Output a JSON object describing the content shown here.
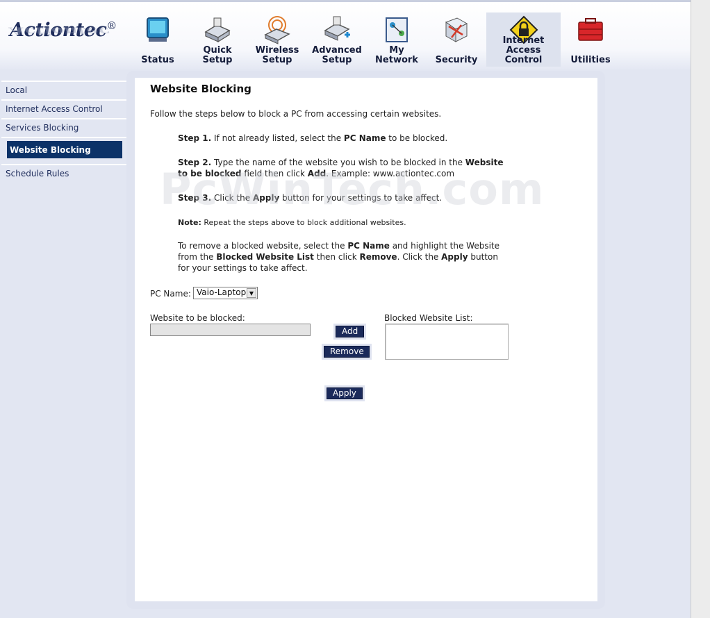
{
  "brand": {
    "name": "Actiontec",
    "mark": "®"
  },
  "nav": [
    {
      "label": "Status",
      "icon": "status-icon"
    },
    {
      "label": "Quick\nSetup",
      "icon": "quick-setup-icon"
    },
    {
      "label": "Wireless\nSetup",
      "icon": "wireless-setup-icon"
    },
    {
      "label": "Advanced\nSetup",
      "icon": "advanced-setup-icon"
    },
    {
      "label": "My Network",
      "icon": "my-network-icon"
    },
    {
      "label": "Security",
      "icon": "security-icon"
    },
    {
      "label": "Internet Access\nControl",
      "icon": "internet-access-lock-icon",
      "active": true
    },
    {
      "label": "Utilities",
      "icon": "utilities-toolbox-icon"
    }
  ],
  "sidebar": {
    "items": [
      {
        "label": "Local"
      },
      {
        "label": "Internet Access Control"
      },
      {
        "label": "Services Blocking"
      },
      {
        "label": "Website Blocking",
        "active": true
      },
      {
        "label": "Schedule Rules"
      }
    ]
  },
  "main": {
    "title": "Website Blocking",
    "intro": "Follow the steps below to block a PC from accessing certain websites.",
    "step1": {
      "bold": "Step 1.",
      "text1": " If not already listed, select the ",
      "b2": "PC Name",
      "text2": " to be blocked."
    },
    "step2": {
      "bold": "Step 2.",
      "text1": " Type the name of the website you wish to be blocked in the ",
      "b2": "Website to be blocked",
      "text2": " field then click ",
      "b3": "Add",
      "text3": ". Example: www.actiontec.com"
    },
    "step3": {
      "bold": "Step 3.",
      "text1": " Click the ",
      "b2": "Apply",
      "text2": " button for your settings to take affect."
    },
    "note": {
      "bold": "Note:",
      "text": " Repeat the steps above to block additional websites."
    },
    "remove_help": {
      "t1": "To remove a blocked website, select the ",
      "b1": "PC Name",
      "t2": " and highlight the Website from the ",
      "b2": "Blocked Website List",
      "t3": " then click ",
      "b3": "Remove",
      "t4": ". Click the ",
      "b4": "Apply",
      "t5": " button for your settings to take affect."
    },
    "pc_name_label": "PC Name:",
    "pc_name_value": "Vaio-Laptop",
    "website_label": "Website to be blocked:",
    "website_value": "",
    "blocked_list_label": "Blocked Website List:",
    "add_label": "Add",
    "remove_label": "Remove",
    "apply_label": "Apply"
  },
  "watermark": "PcWinTech.com",
  "colors": {
    "active_nav": "#0c3268",
    "button": "#1b2a5a",
    "background": "#e2e6f2"
  }
}
